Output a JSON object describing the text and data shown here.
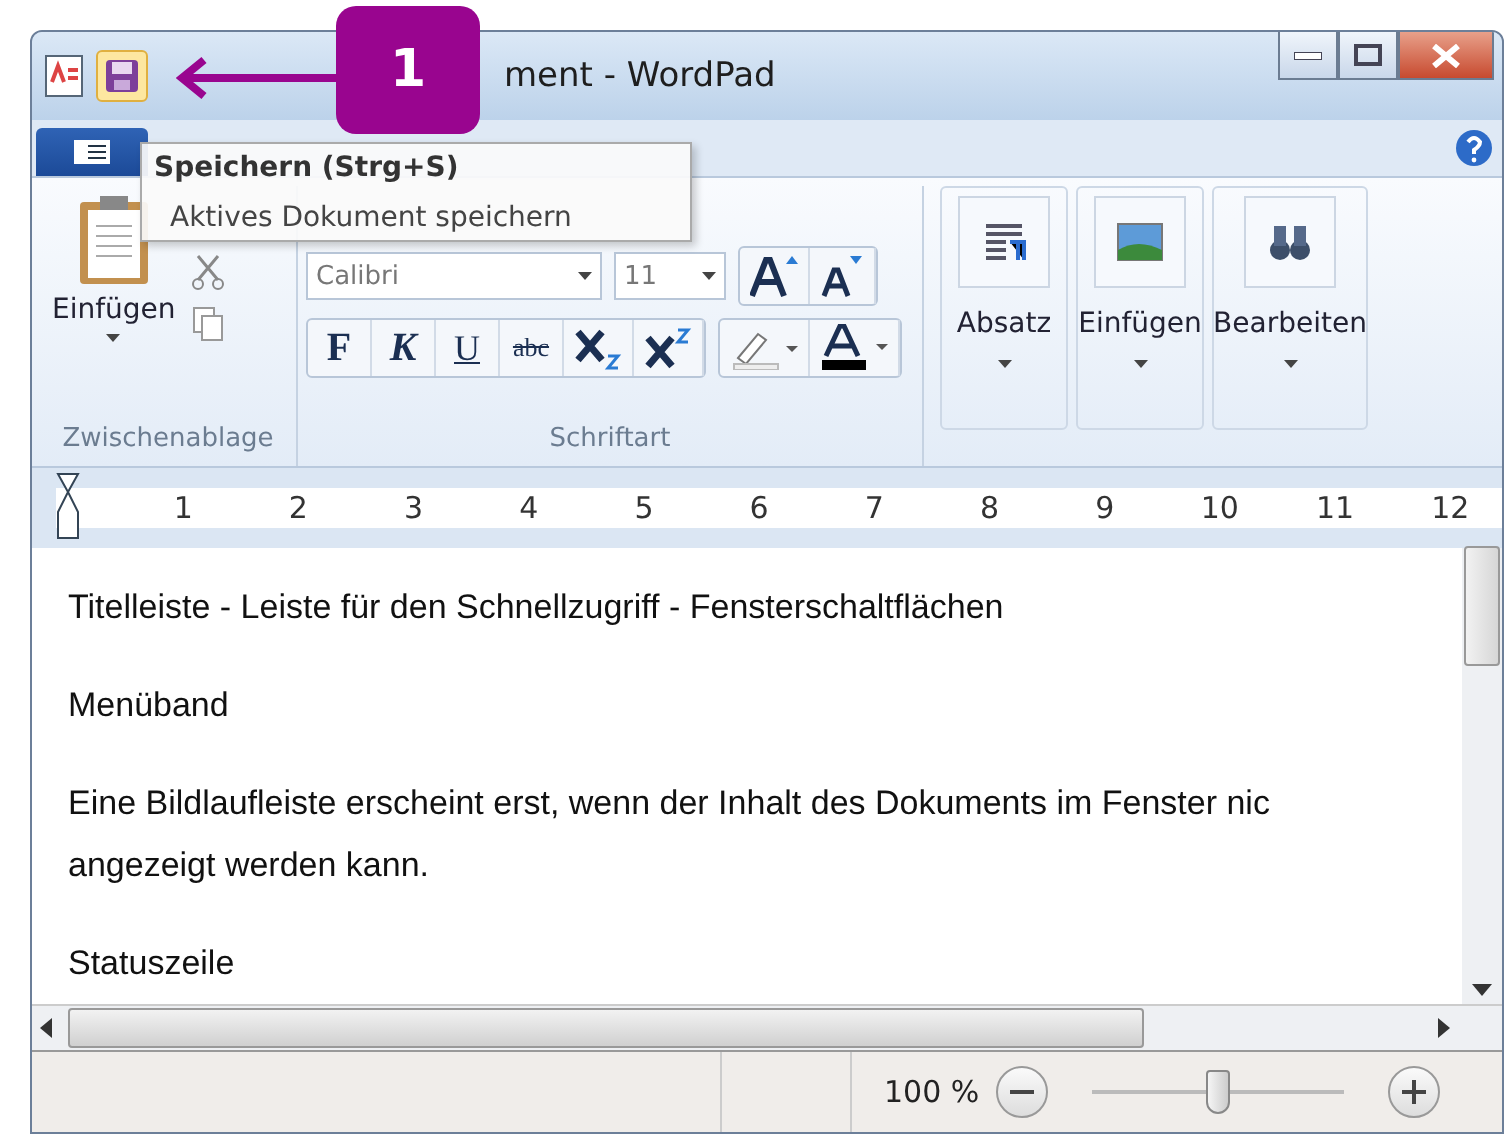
{
  "window": {
    "title": "ment - WordPad"
  },
  "callout": {
    "number": "1"
  },
  "tooltip": {
    "title": "Speichern (Strg+S)",
    "description": "Aktives Dokument speichern"
  },
  "ribbon": {
    "clipboard": {
      "paste_label": "Einfügen",
      "group_label": "Zwischenablage"
    },
    "font": {
      "font_name": "Calibri",
      "font_size": "11",
      "format_buttons": [
        "F",
        "K",
        "U",
        "abc"
      ],
      "group_label": "Schriftart"
    },
    "big_buttons": [
      {
        "kind": "paragraph",
        "label": "Absatz"
      },
      {
        "kind": "picture",
        "label": "Einfügen"
      },
      {
        "kind": "find",
        "label": "Bearbeiten"
      }
    ]
  },
  "ruler": [
    "1",
    "2",
    "3",
    "4",
    "5",
    "6",
    "7",
    "8",
    "9",
    "10",
    "11",
    "12"
  ],
  "document": {
    "paragraphs": [
      [
        "Titelleiste - Leiste für den Schnellzugriff - Fensterschaltflächen"
      ],
      [
        "Menüband"
      ],
      [
        "Eine Bildlaufleiste erscheint erst, wenn der Inhalt des Dokuments im Fenster nic",
        "angezeigt werden kann."
      ],
      [
        "Statuszeile"
      ]
    ]
  },
  "status_bar": {
    "zoom_text": "100 %",
    "zoom": {
      "level": 0.5
    }
  }
}
